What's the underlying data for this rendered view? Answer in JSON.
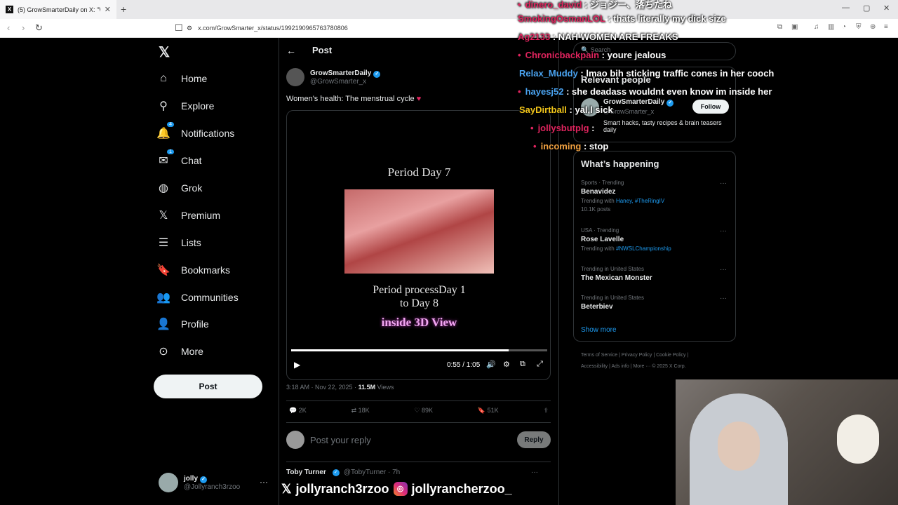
{
  "browser": {
    "tab_title": "(5) GrowSmarterDaily on X: \"Wo",
    "url": "x.com/GrowSmarter_x/status/1992190965763780806"
  },
  "nav": {
    "items": [
      {
        "label": "Home",
        "icon": "home-icon"
      },
      {
        "label": "Explore",
        "icon": "search-icon"
      },
      {
        "label": "Notifications",
        "icon": "bell-icon",
        "badge": "4"
      },
      {
        "label": "Chat",
        "icon": "mail-icon",
        "badge": "1"
      },
      {
        "label": "Grok",
        "icon": "grok-icon"
      },
      {
        "label": "Premium",
        "icon": "x-icon"
      },
      {
        "label": "Lists",
        "icon": "list-icon"
      },
      {
        "label": "Bookmarks",
        "icon": "bookmark-icon"
      },
      {
        "label": "Communities",
        "icon": "people-icon"
      },
      {
        "label": "Profile",
        "icon": "person-icon"
      },
      {
        "label": "More",
        "icon": "more-icon"
      }
    ],
    "post_button": "Post",
    "account": {
      "name": "jolly",
      "handle": "@Jollyranch3rzoo"
    }
  },
  "main": {
    "header": "Post",
    "author": {
      "name": "GrowSmarterDaily",
      "handle": "@GrowSmarter_x"
    },
    "text": "Women's health: The menstrual cycle",
    "media": {
      "title": "Period Day 7",
      "line1": "Period processDay 1",
      "line2": "to Day 8",
      "line3": "inside 3D View",
      "time": "0:55 / 1:05",
      "progress": 0.85
    },
    "meta": {
      "time": "3:18 AM · Nov 22, 2025 · ",
      "views": "11.5M",
      "views_label": " Views"
    },
    "actions": {
      "replies": "2K",
      "reposts": "18K",
      "likes": "89K",
      "bookmarks": "51K"
    },
    "reply_placeholder": "Post your reply",
    "reply_button": "Reply",
    "comment": {
      "name": "Toby Turner",
      "handle": "@TobyTurner · 7h"
    }
  },
  "overlay": {
    "x_handle": "jollyranch3rzoo",
    "ig_handle": "jollyrancherzoo_"
  },
  "right": {
    "search_placeholder": "Search",
    "relevant": {
      "title": "Relevant people",
      "name": "GrowSmarterDaily",
      "handle": "@GrowSmarter_x",
      "bio": "Smart hacks, tasty recipes & brain teasers daily",
      "follow": "Follow"
    },
    "happening": {
      "title": "What’s happening",
      "trends": [
        {
          "context": "Sports · Trending",
          "name": "Benavidez",
          "sub": "Trending with ",
          "tags": "Haney, #TheRingIV",
          "count": "10.1K posts"
        },
        {
          "context": "USA · Trending",
          "name": "Rose Lavelle",
          "sub": "Trending with ",
          "tags": "#NWSLChampionship",
          "count": ""
        },
        {
          "context": "Trending in United States",
          "name": "The Mexican Monster",
          "sub": "",
          "tags": "",
          "count": ""
        },
        {
          "context": "Trending in United States",
          "name": "Beterbiev",
          "sub": "",
          "tags": "",
          "count": ""
        }
      ],
      "show_more": "Show more"
    },
    "footer1": "Terms of Service  |  Privacy Policy  |  Cookie Policy  |",
    "footer2": "Accessibility  |  Ads info  |  More ···  © 2025 X Corp."
  },
  "chat": [
    {
      "user": "dinero_david",
      "msg": " : ジョジー、落ちたね",
      "color": "#e0245e",
      "dot": true
    },
    {
      "user": "SmokingOsmanLOL",
      "msg": " : thats literally my dick size",
      "color": "#e0245e",
      "dot": false
    },
    {
      "user": "Ag2133",
      "msg": " : NAH WOMEN ARE FREAKS",
      "color": "#e0245e",
      "dot": false
    },
    {
      "user": "Chronicbackpain",
      "msg": " : youre jealous",
      "color": "#e0245e",
      "dot": true
    },
    {
      "user": "Relax_Muddy",
      "msg": " : lmao bih sticking traffic cones in her cooch",
      "color": "#4aa3f0",
      "dot": false
    },
    {
      "user": "hayesj52",
      "msg": " : she deadass wouldnt even know im inside her",
      "color": "#4aa3f0",
      "dot": true
    },
    {
      "user": "SayDirtball",
      "msg": " : yal,l sick",
      "color": "#f0c419",
      "dot": false
    },
    {
      "user": "jollysbutplg",
      "msg": " : ",
      "color": "#e0245e",
      "dot": true
    },
    {
      "user": "incoming",
      "msg": " : stop",
      "color": "#f0a040",
      "dot": true
    }
  ]
}
